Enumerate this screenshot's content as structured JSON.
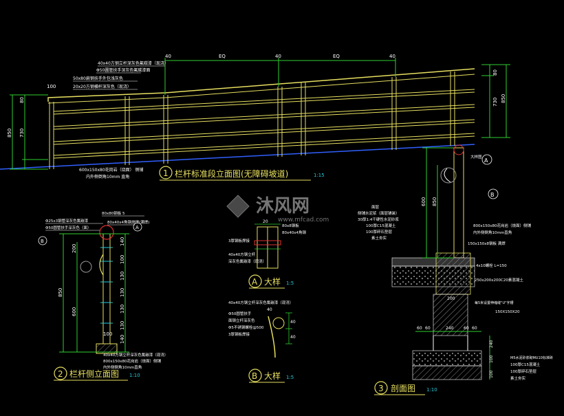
{
  "colors": {
    "bg": "#000000",
    "rail": "#e8e060",
    "dim": "#2fd12f",
    "text": "#ffffff",
    "cyan": "#27c8d8",
    "red": "#e03030",
    "hatch": "#9a9a9a",
    "watermark": "#8a8a8a"
  },
  "watermark": {
    "brand": "沐风网",
    "url": "www.mfcad.com"
  },
  "elevation": {
    "title": "栏杆标准段立面图(无障碍坡道)",
    "scale": "1:15",
    "number": "1",
    "dims_top": [
      "40",
      "EQ",
      "40",
      "EQ",
      "40"
    ],
    "dims_left": [
      "850",
      "730",
      "80",
      "100"
    ],
    "dims_right": [
      "850",
      "730",
      "80"
    ],
    "notes": [
      "40x40方钢立杆深灰色氟碳漆（现浇）",
      "Φ50圆管扶手深灰色氟碳漆面",
      "50x80扁钢扶手外包浅灰色",
      "20x20方钢横杆深灰色（现浇）"
    ],
    "base_note": "600x150x80花岗岩（烧面） 侧铺",
    "base_note2": "内外侧倒角10mm 直角"
  },
  "side": {
    "title": "栏杆侧立面图",
    "scale": "1:10",
    "number": "2",
    "dims": [
      "850",
      "600",
      "200",
      "140",
      "100",
      "130",
      "130",
      "130",
      "130",
      "140",
      "100"
    ],
    "notes": [
      "Φ25x3钢管深灰色氟碳漆",
      "Φ50圆管扶手深灰色（面）",
      "80x80钢板 5",
      "80x40x4角钢烧焊(满焊)"
    ],
    "base_notes": [
      "40x40方钢立杆深灰色氟碳漆（现浇）",
      "800x150x80花岗岩（烧面）侧铺",
      "内外侧倒角10mm直角"
    ]
  },
  "detailA": {
    "title": "大样",
    "letter": "A",
    "scale": "1:5",
    "notes": [
      "80x8钢板",
      "80x40x4角钢",
      "20",
      "3厚钢板焊接",
      "40x40方钢立杆",
      "深灰色氟碳漆（现浇）"
    ]
  },
  "detailB": {
    "title": "大样",
    "letter": "B",
    "scale": "1:5",
    "notes": [
      "40x40方钢立杆深灰色氟碳漆（现浇）",
      "Φ50圆管扶手",
      "面钢立杆深灰色",
      "Φ5不锈钢螺栓@500",
      "3厚钢板焊接"
    ],
    "dims": [
      "40",
      "40",
      "40"
    ]
  },
  "section": {
    "title": "剖面图",
    "number": "3",
    "scale": "1:10",
    "dims_vert": [
      "600",
      "850"
    ],
    "dims_bottom": [
      "60",
      "60",
      "240",
      "60",
      "60"
    ],
    "dims_right": [
      "240",
      "100",
      "100"
    ],
    "dim_200": "200",
    "notes_left": [
      "面层",
      "侧铺水泥浆（面层铺装）",
      "30厚1:4干硬性水泥砂浆",
      "100厚C15混凝土",
      "100厚碎石垫层",
      "素土夯实"
    ],
    "notes_right": [
      "800x150x80花岗岩（烧面）侧铺",
      "内外侧倒角10mm直角",
      "150x150x8钢板 满焊",
      "4x10螺栓 L=150",
      "250x200x200C20素混凝土",
      "每5米设置伸缩缝\"U\"字槽",
      "150X150X20"
    ],
    "base_notes": [
      "M5水泥砂浆砌MU10标准砖",
      "100厚C15混凝土",
      "100厚碎石垫层",
      "素土夯实"
    ],
    "circle_labels": [
      "A",
      "B"
    ],
    "handrail_label": "大样图"
  }
}
